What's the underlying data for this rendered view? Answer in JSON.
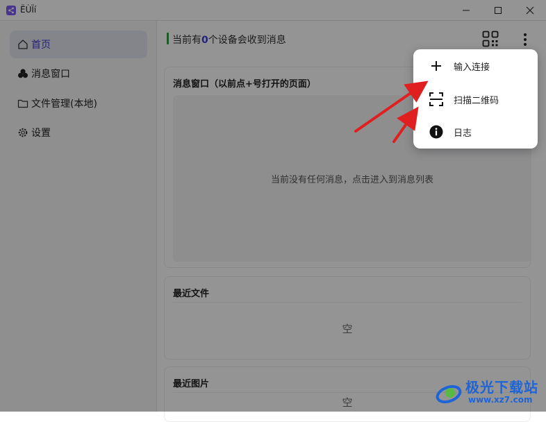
{
  "window": {
    "title": "ËÙÏí",
    "minimize_icon": "minimize-icon",
    "maximize_icon": "maximize-icon",
    "close_icon": "close-icon"
  },
  "sidebar": {
    "items": [
      {
        "label": "首页",
        "icon": "home-icon",
        "active": true
      },
      {
        "label": "消息窗口",
        "icon": "bubbles-icon",
        "active": false
      },
      {
        "label": "文件管理(本地)",
        "icon": "folder-icon",
        "active": false
      },
      {
        "label": "设置",
        "icon": "gear-icon",
        "active": false
      }
    ]
  },
  "header": {
    "status_prefix": "当前有",
    "device_count": "0",
    "status_suffix": "个设备会收到消息",
    "qr_icon": "qr-code-icon",
    "more_icon": "more-vertical-icon"
  },
  "cards": {
    "messages": {
      "title": "消息窗口（以前点+号打开的页面）",
      "empty": "当前没有任何消息，点击进入到消息列表"
    },
    "recent_files": {
      "title": "最近文件",
      "empty": "空"
    },
    "recent_images": {
      "title": "最近图片",
      "empty": "空"
    }
  },
  "menu": {
    "items": [
      {
        "label": "输入连接",
        "icon": "plus-icon"
      },
      {
        "label": "扫描二维码",
        "icon": "scan-icon"
      },
      {
        "label": "日志",
        "icon": "info-icon"
      }
    ]
  },
  "watermark": {
    "brand": "极光下载站",
    "url": "www.xz7.com"
  },
  "colors": {
    "accent": "#3d3ad0",
    "status_green": "#2f9e44",
    "arrow_red": "#e02020",
    "watermark_blue": "#1f64d6"
  }
}
